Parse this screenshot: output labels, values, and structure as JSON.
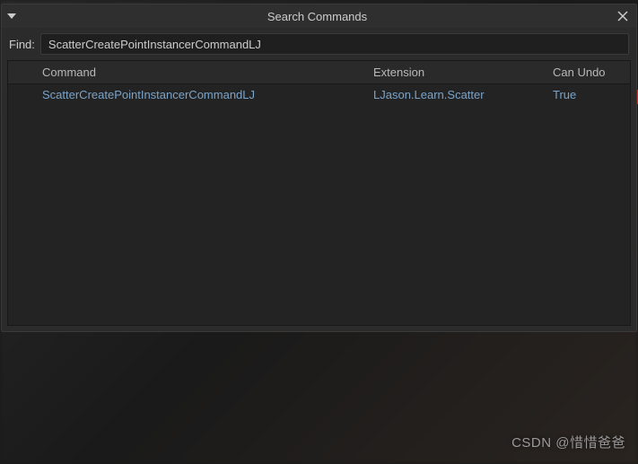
{
  "dialog": {
    "title": "Search Commands",
    "find_label": "Find:",
    "find_value": "ScatterCreatePointInstancerCommandLJ"
  },
  "table": {
    "headers": {
      "command": "Command",
      "extension": "Extension",
      "can_undo": "Can Undo"
    },
    "rows": [
      {
        "command": "ScatterCreatePointInstancerCommandLJ",
        "extension": "LJason.Learn.Scatter",
        "can_undo": "True"
      }
    ]
  },
  "watermark": "CSDN @惜惜爸爸"
}
